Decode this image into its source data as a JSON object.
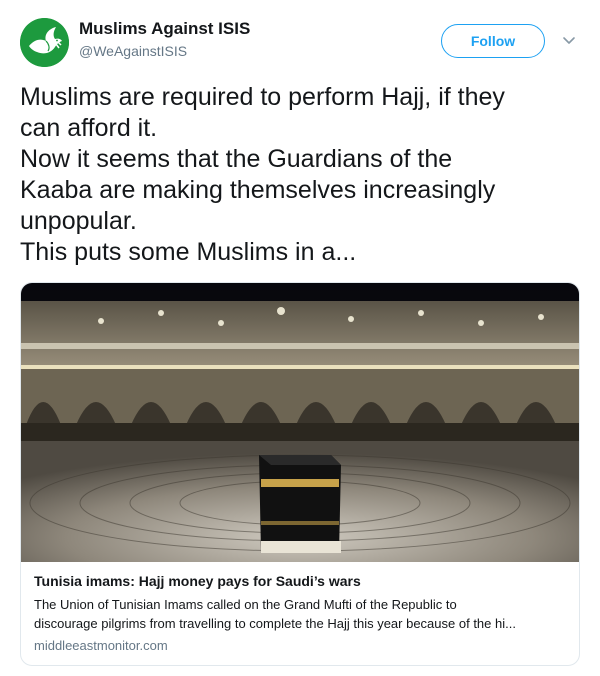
{
  "author": {
    "name": "Muslims Against ISIS",
    "handle": "@WeAgainstISIS",
    "avatar_icon": "dove-icon",
    "avatar_color": "#1d9a3e"
  },
  "follow_button": {
    "label": "Follow",
    "color": "#1da1f2"
  },
  "menu_icon": "chevron-down-icon",
  "tweet_text": {
    "lines": [
      "Muslims are required to perform Hajj, if they",
      "can afford it.",
      "Now it seems that the Guardians of the",
      "Kaaba are making themselves increasingly",
      "unpopular.",
      "This puts some Muslims in a..."
    ]
  },
  "link_card": {
    "image_description_icon": "kaaba-photo",
    "title": "Tunisia imams: Hajj money pays for Saudi’s wars",
    "description_lines": [
      "The Union of Tunisian Imams called on the Grand Mufti of the Republic to",
      "discourage pilgrims from travelling to complete the Hajj this year because of the hi..."
    ],
    "domain": "middleeastmonitor.com"
  }
}
